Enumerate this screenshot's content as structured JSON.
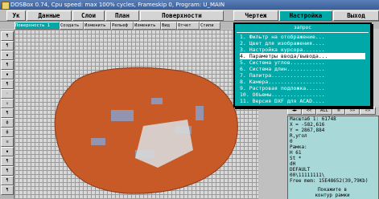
{
  "window": {
    "title": "DOSBox 0.74, Cpu speed: max 100% cycles, Frameskip 0, Program: U_MAIN"
  },
  "menubar": {
    "items": [
      {
        "label": "Ук"
      },
      {
        "label": "Данные"
      },
      {
        "label": "Слои"
      },
      {
        "label": "План"
      },
      {
        "label": "Поверхности"
      },
      {
        "label": "Чертеж"
      },
      {
        "label": "Настройка"
      },
      {
        "label": "Выход"
      }
    ],
    "active_index": 6
  },
  "toolbar": {
    "items": [
      {
        "label": "Поверхность 1"
      },
      {
        "label": "Создать"
      },
      {
        "label": "Изменить"
      },
      {
        "label": "Рельеф"
      },
      {
        "label": "Изменить"
      },
      {
        "label": "Вид"
      },
      {
        "label": "Отчет"
      },
      {
        "label": "Стили"
      }
    ]
  },
  "popup": {
    "title": "запрос",
    "items": [
      "1. Фильтр на отображение...",
      "2. Цвет для изображения....",
      "3. Настройка курсора.......",
      "4. Параметры ввода/вывода...",
      "5. Система углов...........",
      "6. Система длин............",
      "7. Палитра.................",
      "8. Камера..................",
      "9. Растровая подложка......",
      "10. Объемы.................",
      "11. Версия DXF для ACAD...."
    ],
    "selected_index": 3
  },
  "right_tools": [
    "◄►",
    "<<",
    "ALL",
    "®",
    "»»",
    "«»"
  ],
  "info_panel": {
    "lines": [
      "Масштаб  1: 61748",
      "X    =    -582,616",
      "Y    =    2867,884",
      "R,угол",
      "0",
      "Рамка:",
      "H  61",
      "St  *",
      "dH",
      "DEFAULT",
      "00\\11111111\\",
      "Free mem: 15E48652(39,79Kb)"
    ],
    "hint_lines": [
      "Покажите в",
      "контур рамки"
    ]
  },
  "colors": {
    "accent": "#00a8a8",
    "shape_fill": "#c85a28"
  }
}
